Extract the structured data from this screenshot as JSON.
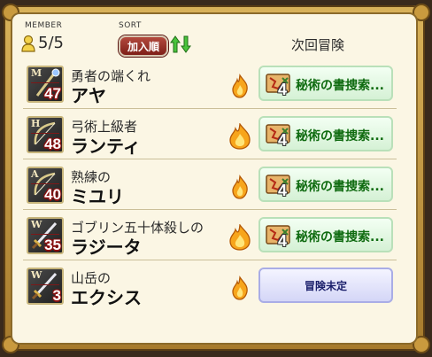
{
  "header": {
    "member_label": "MEMBER",
    "member_count": "5/5",
    "sort_label": "SORT",
    "sort_button": "加入順",
    "next_adventure": "次回冒険"
  },
  "members": [
    {
      "title": "勇者の端くれ",
      "name": "アヤ",
      "job_letter": "M",
      "level": "47",
      "job_icon": "staff-icon",
      "flame": "small",
      "quest": {
        "count": "4",
        "text": "秘術の書捜索...",
        "icon": "treasure-map-icon"
      }
    },
    {
      "title": "弓術上級者",
      "name": "ランティ",
      "job_letter": "H",
      "level": "48",
      "job_icon": "bow-icon",
      "flame": "large",
      "quest": {
        "count": "4",
        "text": "秘術の書捜索...",
        "icon": "treasure-map-icon"
      }
    },
    {
      "title": "熟練の",
      "name": "ミユリ",
      "job_letter": "A",
      "level": "40",
      "job_icon": "bow-icon",
      "flame": "small",
      "quest": {
        "count": "4",
        "text": "秘術の書捜索...",
        "icon": "treasure-map-icon"
      }
    },
    {
      "title": "ゴブリン五十体殺しの",
      "name": "ラジータ",
      "job_letter": "W",
      "level": "35",
      "job_icon": "sword-icon",
      "flame": "large",
      "quest": {
        "count": "4",
        "text": "秘術の書捜索...",
        "icon": "treasure-map-icon"
      }
    },
    {
      "title": "山岳の",
      "name": "エクシス",
      "job_letter": "W",
      "level": "3",
      "job_icon": "sword-icon",
      "flame": "small",
      "quest": null,
      "undecided": "冒険未定"
    }
  ],
  "colors": {
    "panel_bg": "#fbf6e4",
    "frame_gold": "#c99a3e",
    "quest_green": "#0f6b10",
    "level_red": "#8a1010",
    "sort_red": "#9c2f25"
  }
}
